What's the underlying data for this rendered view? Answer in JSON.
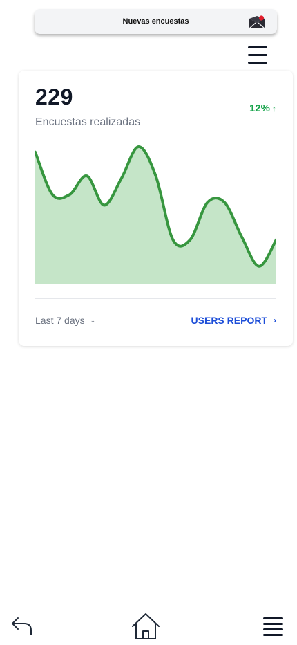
{
  "notification": {
    "title": "Nuevas encuestas",
    "icon": "mail-icon"
  },
  "header": {
    "menu_icon": "hamburger-icon"
  },
  "card": {
    "value": "229",
    "subtitle": "Encuestas realizadas",
    "change": "12%",
    "change_icon": "arrow-up-icon",
    "period_label": "Last 7 days",
    "report_label": "USERS REPORT"
  },
  "chart_data": {
    "type": "area",
    "x": [
      1,
      2,
      3,
      4,
      5,
      6,
      7,
      8,
      9,
      10,
      11,
      12,
      13,
      14,
      15
    ],
    "values": [
      96,
      64,
      64,
      78,
      56,
      76,
      100,
      78,
      30,
      30,
      58,
      58,
      32,
      10,
      30
    ],
    "ylim": [
      0,
      100
    ],
    "grid": false,
    "colors": {
      "line": "#37963f",
      "fill": "#c5e5c8"
    }
  },
  "bottom_nav": {
    "back_icon": "back-arrow-icon",
    "home_icon": "home-icon",
    "menu_icon": "hamburger-icon"
  },
  "colors": {
    "positive": "#16a34a",
    "link": "#1d4ed8",
    "muted_text": "#6b7280",
    "notification_badge": "#e11d2c"
  }
}
